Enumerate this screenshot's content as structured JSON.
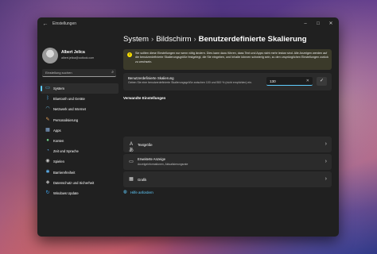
{
  "window": {
    "back_icon": "arrow-left-icon",
    "title": "Einstellungen",
    "controls": {
      "minimize": "–",
      "maximize": "□",
      "close": "✕"
    }
  },
  "user": {
    "name": "Albert Jelica",
    "email": "albert.jelica@outlook.com"
  },
  "search": {
    "placeholder": "Einstellung suchen",
    "icon": "search-icon"
  },
  "sidebar": {
    "items": [
      {
        "label": "System",
        "icon": "system-icon",
        "color": "#4fc3f7",
        "active": true
      },
      {
        "label": "Bluetooth und Geräte",
        "icon": "bluetooth-icon",
        "color": "#4aa3df",
        "active": false
      },
      {
        "label": "Netzwerk und Internet",
        "icon": "wifi-icon",
        "color": "#6ec1e4",
        "active": false
      },
      {
        "label": "Personalisierung",
        "icon": "brush-icon",
        "color": "#e8a45a",
        "active": false
      },
      {
        "label": "Apps",
        "icon": "apps-icon",
        "color": "#8fb8e8",
        "active": false
      },
      {
        "label": "Konten",
        "icon": "person-icon",
        "color": "#6fd38a",
        "active": false
      },
      {
        "label": "Zeit und Sprache",
        "icon": "globe-clock-icon",
        "color": "#5aa9e6",
        "active": false
      },
      {
        "label": "Spielen",
        "icon": "gamepad-icon",
        "color": "#c8c8c8",
        "active": false
      },
      {
        "label": "Barrierefreiheit",
        "icon": "accessibility-icon",
        "color": "#5fb3f0",
        "active": false
      },
      {
        "label": "Datenschutz und Sicherheit",
        "icon": "shield-icon",
        "color": "#a0a0a0",
        "active": false
      },
      {
        "label": "Windows Update",
        "icon": "update-icon",
        "color": "#3fa9f5",
        "active": false
      }
    ]
  },
  "breadcrumb": {
    "parts": [
      "System",
      "Bildschirm"
    ],
    "current": "Benutzerdefinierte Skalierung",
    "separator": "›"
  },
  "warning": {
    "icon": "warning-icon",
    "text": "Sie sollten diese Einstellungen nur wenn nötig ändern. Dies kann dazu führen, dass Text und Apps nicht mehr lesbar sind. Alle Anzeigen werden auf die benutzerdefinierte Skalierungsgröße festgelegt, die Sie eingeben, und Inhalte können schwierig sein, zu den ursprünglichen Einstellungen zurück zu wechseln."
  },
  "custom_scaling": {
    "title": "Benutzerdefinierte Skalierung",
    "description": "Geben Sie eine benutzerdefinierte Skalierungsgröße zwischen 100 und 500 % (nicht empfohlen) ein.",
    "value": "130",
    "clear_icon": "close-icon",
    "apply_icon": "checkmark-icon"
  },
  "related": {
    "title": "Verwandte Einstellungen",
    "items": [
      {
        "label": "Textgröße",
        "sub": "",
        "icon": "text-size-icon"
      },
      {
        "label": "Erweiterte Anzeige",
        "sub": "Anzeigeinformationen, Aktualisierungsrate",
        "icon": "monitor-icon"
      },
      {
        "label": "Grafik",
        "sub": "",
        "icon": "graphics-icon"
      }
    ]
  },
  "help": {
    "label": "Hilfe anfordern",
    "icon": "help-icon"
  }
}
